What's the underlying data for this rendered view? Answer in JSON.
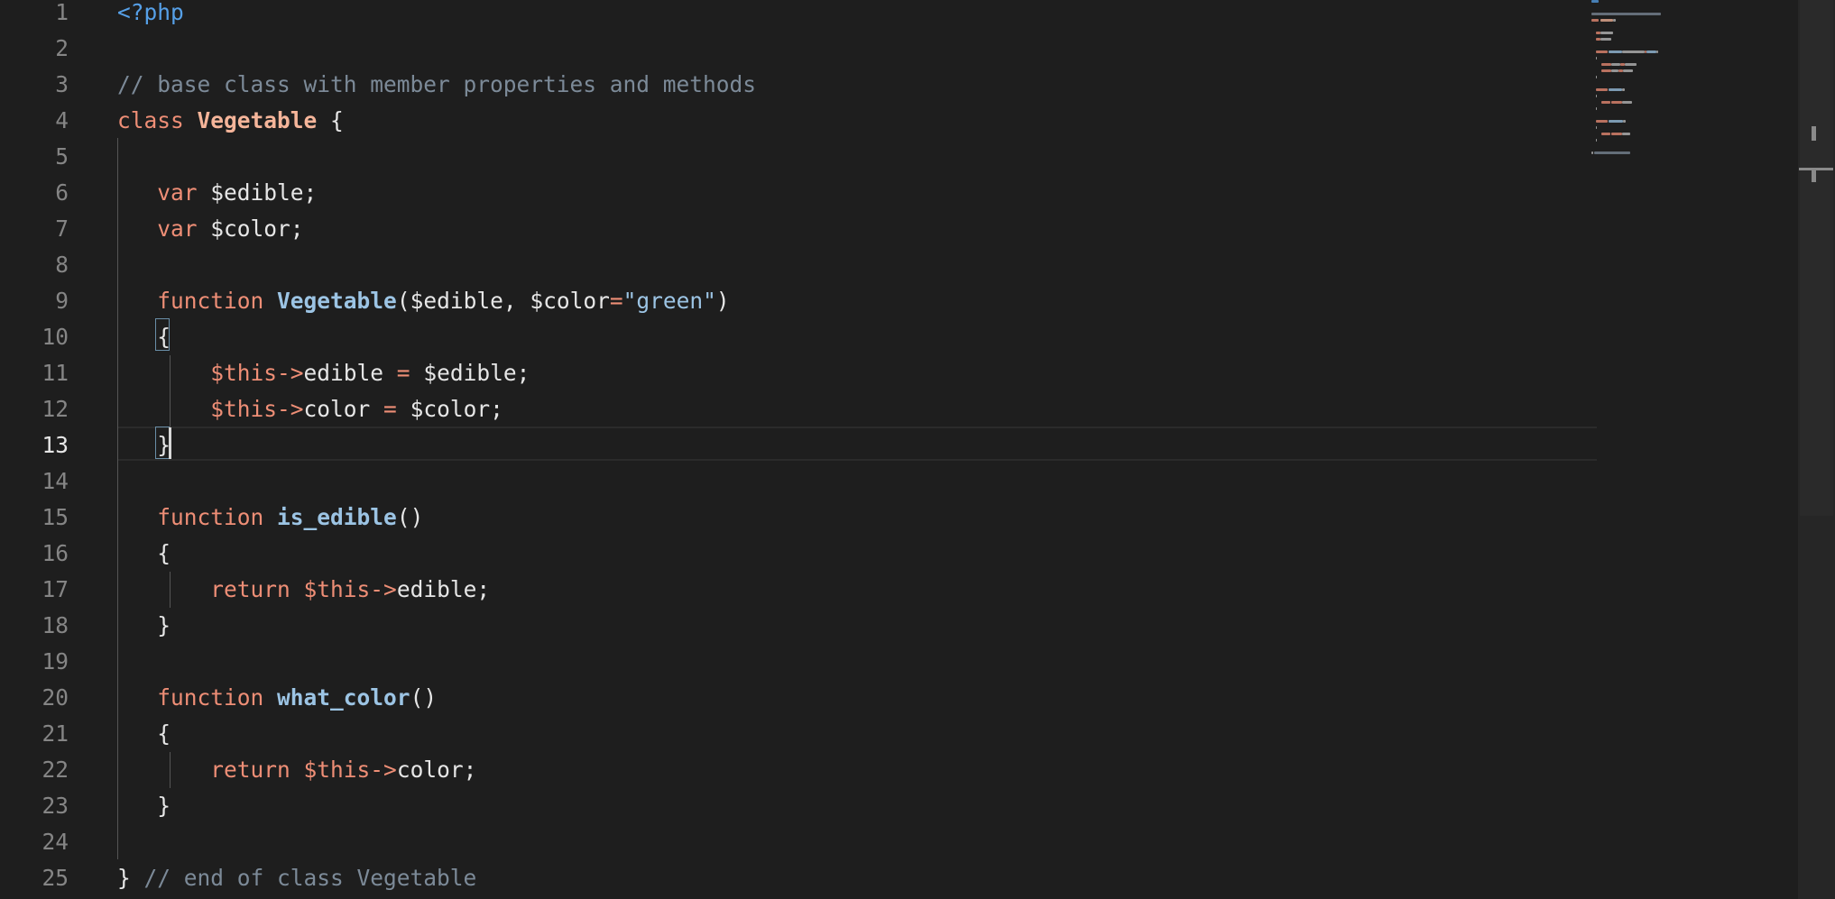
{
  "editor": {
    "language": "php",
    "active_line": 13
  },
  "lines": [
    {
      "n": "1",
      "tokens": [
        {
          "t": "<?php",
          "c": "php-tag"
        }
      ]
    },
    {
      "n": "2",
      "tokens": []
    },
    {
      "n": "3",
      "tokens": [
        {
          "t": "// base class with member properties and methods",
          "c": "comment"
        }
      ]
    },
    {
      "n": "4",
      "tokens": [
        {
          "t": "class",
          "c": "kw"
        },
        {
          "t": " ",
          "c": "plain"
        },
        {
          "t": "Vegetable",
          "c": "cls-name"
        },
        {
          "t": " {",
          "c": "punct"
        }
      ]
    },
    {
      "n": "5",
      "tokens": []
    },
    {
      "n": "6",
      "tokens": [
        {
          "t": "   ",
          "c": "plain"
        },
        {
          "t": "var",
          "c": "kw"
        },
        {
          "t": " $edible;",
          "c": "var"
        }
      ]
    },
    {
      "n": "7",
      "tokens": [
        {
          "t": "   ",
          "c": "plain"
        },
        {
          "t": "var",
          "c": "kw"
        },
        {
          "t": " $color;",
          "c": "var"
        }
      ]
    },
    {
      "n": "8",
      "tokens": []
    },
    {
      "n": "9",
      "tokens": [
        {
          "t": "   ",
          "c": "plain"
        },
        {
          "t": "function",
          "c": "kw"
        },
        {
          "t": " ",
          "c": "plain"
        },
        {
          "t": "Vegetable",
          "c": "fn-name"
        },
        {
          "t": "($edible, $color",
          "c": "var"
        },
        {
          "t": "=",
          "c": "op"
        },
        {
          "t": "\"green\"",
          "c": "str"
        },
        {
          "t": ")",
          "c": "punct"
        }
      ]
    },
    {
      "n": "10",
      "tokens": [
        {
          "t": "   ",
          "c": "plain"
        },
        {
          "t": "{",
          "c": "punct"
        }
      ]
    },
    {
      "n": "11",
      "tokens": [
        {
          "t": "       ",
          "c": "plain"
        },
        {
          "t": "$this->",
          "c": "this-var"
        },
        {
          "t": "edible",
          "c": "var"
        },
        {
          "t": " = ",
          "c": "op"
        },
        {
          "t": "$edible;",
          "c": "var"
        }
      ]
    },
    {
      "n": "12",
      "tokens": [
        {
          "t": "       ",
          "c": "plain"
        },
        {
          "t": "$this->",
          "c": "this-var"
        },
        {
          "t": "color",
          "c": "var"
        },
        {
          "t": " = ",
          "c": "op"
        },
        {
          "t": "$color;",
          "c": "var"
        }
      ]
    },
    {
      "n": "13",
      "tokens": [
        {
          "t": "   ",
          "c": "plain"
        },
        {
          "t": "}",
          "c": "punct"
        }
      ]
    },
    {
      "n": "14",
      "tokens": []
    },
    {
      "n": "15",
      "tokens": [
        {
          "t": "   ",
          "c": "plain"
        },
        {
          "t": "function",
          "c": "kw"
        },
        {
          "t": " ",
          "c": "plain"
        },
        {
          "t": "is_edible",
          "c": "fn-name"
        },
        {
          "t": "()",
          "c": "punct"
        }
      ]
    },
    {
      "n": "16",
      "tokens": [
        {
          "t": "   ",
          "c": "plain"
        },
        {
          "t": "{",
          "c": "punct"
        }
      ]
    },
    {
      "n": "17",
      "tokens": [
        {
          "t": "       ",
          "c": "plain"
        },
        {
          "t": "return",
          "c": "kw"
        },
        {
          "t": " ",
          "c": "plain"
        },
        {
          "t": "$this->",
          "c": "this-var"
        },
        {
          "t": "edible;",
          "c": "var"
        }
      ]
    },
    {
      "n": "18",
      "tokens": [
        {
          "t": "   ",
          "c": "plain"
        },
        {
          "t": "}",
          "c": "punct"
        }
      ]
    },
    {
      "n": "19",
      "tokens": []
    },
    {
      "n": "20",
      "tokens": [
        {
          "t": "   ",
          "c": "plain"
        },
        {
          "t": "function",
          "c": "kw"
        },
        {
          "t": " ",
          "c": "plain"
        },
        {
          "t": "what_color",
          "c": "fn-name"
        },
        {
          "t": "()",
          "c": "punct"
        }
      ]
    },
    {
      "n": "21",
      "tokens": [
        {
          "t": "   ",
          "c": "plain"
        },
        {
          "t": "{",
          "c": "punct"
        }
      ]
    },
    {
      "n": "22",
      "tokens": [
        {
          "t": "       ",
          "c": "plain"
        },
        {
          "t": "return",
          "c": "kw"
        },
        {
          "t": " ",
          "c": "plain"
        },
        {
          "t": "$this->",
          "c": "this-var"
        },
        {
          "t": "color;",
          "c": "var"
        }
      ]
    },
    {
      "n": "23",
      "tokens": [
        {
          "t": "   ",
          "c": "plain"
        },
        {
          "t": "}",
          "c": "punct"
        }
      ]
    },
    {
      "n": "24",
      "tokens": []
    },
    {
      "n": "25",
      "tokens": [
        {
          "t": "}",
          "c": "punct"
        },
        {
          "t": " ",
          "c": "plain"
        },
        {
          "t": "// end of class Vegetable",
          "c": "comment"
        }
      ]
    }
  ],
  "colors": {
    "background": "#1e1e1e",
    "keyword": "#ee8e76",
    "function_name": "#9cc4e4",
    "class_name": "#f5b59a",
    "comment": "#7c8a98",
    "php_tag": "#56a0e8",
    "line_number": "#858585"
  }
}
